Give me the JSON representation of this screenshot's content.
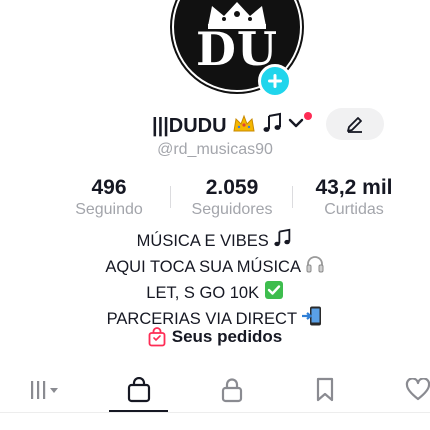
{
  "profile": {
    "avatar_text": "DU",
    "username": "|||DUDU",
    "handle": "@rd_musicas90"
  },
  "stats": [
    {
      "value": "496",
      "label": "Seguindo"
    },
    {
      "value": "2.059",
      "label": "Seguidores"
    },
    {
      "value": "43,2 mil",
      "label": "Curtidas"
    }
  ],
  "bio": [
    "MÚSICA E VIBES",
    "AQUI TOCA SUA MÚSICA",
    "LET, S GO 10K",
    "PARCERIAS VIA DIRECT"
  ],
  "orders": {
    "label": "Seus pedidos"
  },
  "tabs": [
    {
      "icon": "grid-filter-icon",
      "active": false
    },
    {
      "icon": "shopping-bag-icon",
      "active": true
    },
    {
      "icon": "lock-icon",
      "active": false
    },
    {
      "icon": "bookmark-icon",
      "active": false
    },
    {
      "icon": "heart-icon",
      "active": false
    }
  ],
  "colors": {
    "accent_plus": "#20d5ec",
    "notification_dot": "#fe2c55",
    "secondary_text": "#a3a5ab",
    "orders_icon": "#fe2c55"
  }
}
